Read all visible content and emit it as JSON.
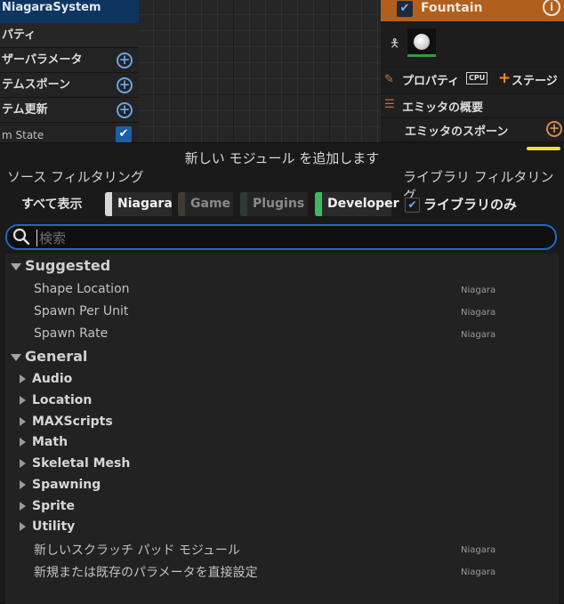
{
  "left_panel": {
    "system_tab": "NiagaraSystem",
    "header": "パティ",
    "rows": [
      {
        "label": "ザーパラメータ",
        "action": "plus"
      },
      {
        "label": "テムスポーン",
        "action": "plus"
      },
      {
        "label": "テム更新",
        "action": "plus"
      },
      {
        "label": "m State",
        "action": "check"
      }
    ]
  },
  "emitter_panel": {
    "title": "Fountain",
    "properties_label": "プロパティ",
    "cpu_label": "CPU",
    "stage_label": "ステージ",
    "overview_label": "エミッタの概要",
    "spawn_label": "エミッタのスポーン"
  },
  "dialog": {
    "title": "新しい モジュール を追加します",
    "source_filter_label": "ソース フィルタリング",
    "library_filter_label": "ライブラリ フィルタリング",
    "show_all": "すべて表示",
    "chips": [
      {
        "label": "Niagara",
        "color": "#d8d8d8",
        "active": true
      },
      {
        "label": "Game",
        "color": "#3e3a33",
        "active": false
      },
      {
        "label": "Plugins",
        "color": "#2e3a38",
        "active": false
      },
      {
        "label": "Developer",
        "color": "#3fba5a",
        "active": true
      }
    ],
    "library_only": "ライブラリのみ",
    "search_placeholder": "検索",
    "categories": {
      "suggested": "Suggested",
      "general": "General"
    },
    "suggested_items": [
      {
        "name": "Shape Location",
        "source": "Niagara"
      },
      {
        "name": "Spawn Per Unit",
        "source": "Niagara"
      },
      {
        "name": "Spawn Rate",
        "source": "Niagara"
      }
    ],
    "groups": [
      "Audio",
      "Location",
      "MAXScripts",
      "Math",
      "Skeletal Mesh",
      "Spawning",
      "Sprite",
      "Utility"
    ],
    "general_items": [
      {
        "name": "新しいスクラッチ パッド モジュール",
        "source": "Niagara"
      },
      {
        "name": "新規または既存のパラメータを直接設定",
        "source": "Niagara"
      }
    ]
  }
}
